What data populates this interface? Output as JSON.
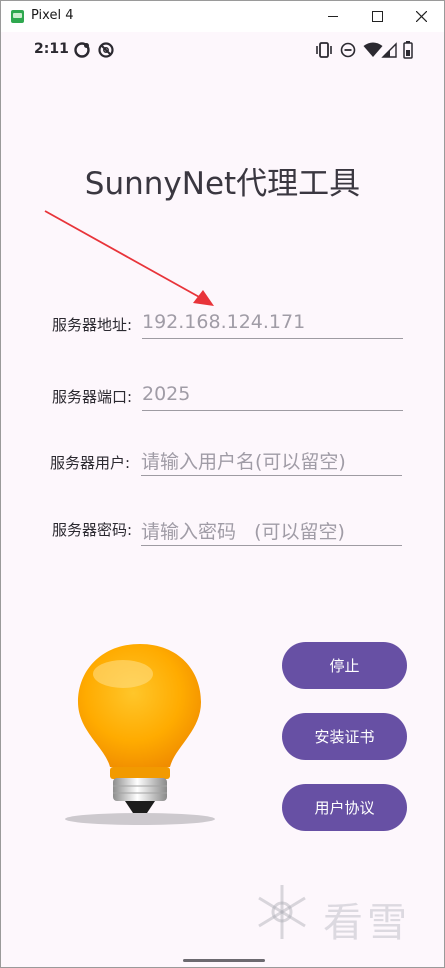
{
  "window": {
    "title": "Pixel 4"
  },
  "status_bar": {
    "time": "2:11"
  },
  "app": {
    "title": "SunnyNet代理工具"
  },
  "form": {
    "server_address": {
      "label": "服务器地址:",
      "value": "192.168.124.171"
    },
    "server_port": {
      "label": "服务器端口:",
      "value": "2025"
    },
    "server_user": {
      "label": "服务器用户:",
      "placeholder": "请输入用户名(可以留空)"
    },
    "server_password": {
      "label": "服务器密码:",
      "placeholder": "请输入密码   (可以留空)"
    }
  },
  "buttons": {
    "stop": "停止",
    "install_cert": "安装证书",
    "user_agreement": "用户协议"
  },
  "colors": {
    "button": "#6750a4",
    "annotation_arrow": "#e8343a",
    "bulb": "#ffb300"
  },
  "icons": [
    "emulator-app-icon",
    "minimize-icon",
    "maximize-icon",
    "close-icon",
    "sync-icon",
    "no-disturb-icon",
    "vibrate-icon",
    "dnd-icon",
    "wifi-icon",
    "signal-icon",
    "battery-icon",
    "lightbulb-icon",
    "red-arrow-annotation"
  ],
  "watermark": "看雪"
}
